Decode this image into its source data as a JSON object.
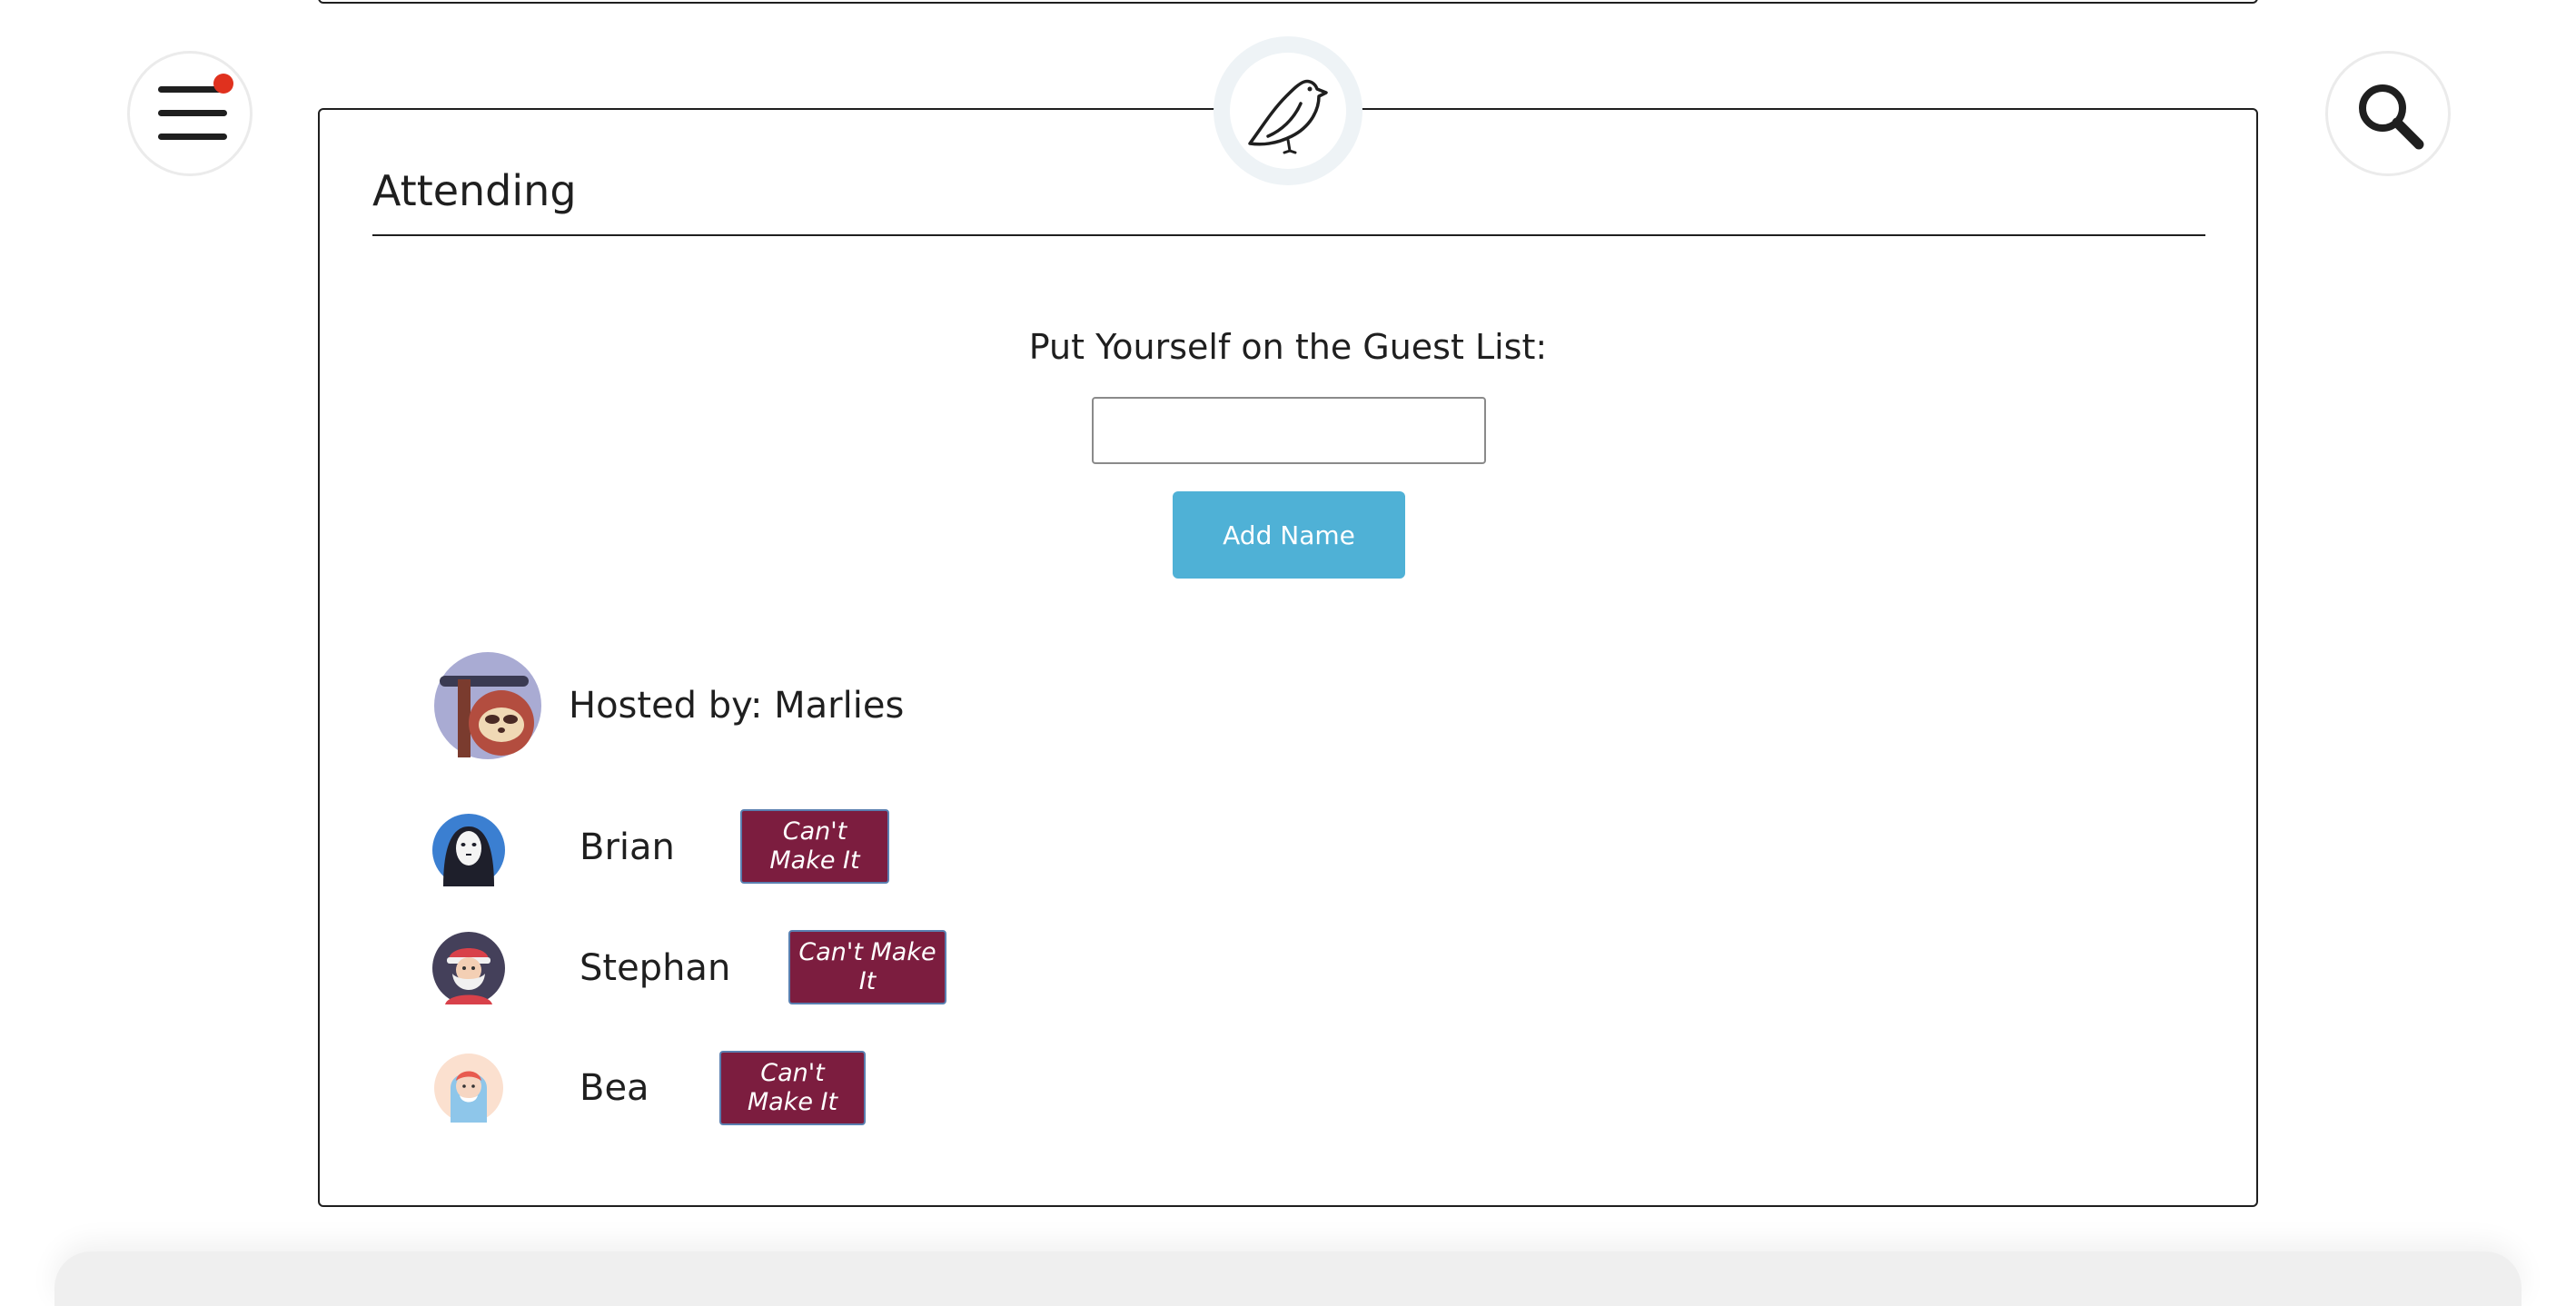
{
  "colors": {
    "accent_button": "#4fb1d6",
    "cant_button": "#7c1d3f",
    "notification_dot": "#e0311e",
    "text": "#1f1f1f"
  },
  "header": {
    "menu_icon": "hamburger-icon",
    "has_notification": true,
    "search_icon": "search-icon",
    "logo_icon": "bird-icon"
  },
  "attending": {
    "title": "Attending",
    "guest_list_label": "Put Yourself on the Guest List:",
    "name_input": {
      "value": "",
      "placeholder": ""
    },
    "add_button_label": "Add Name",
    "host": {
      "label": "Hosted by: Marlies",
      "avatar_icon": "sloth-avatar-icon"
    },
    "guests": [
      {
        "name": "Brian",
        "avatar_icon": "no-face-avatar-icon",
        "button_label": "Can't Make It"
      },
      {
        "name": "Stephan",
        "avatar_icon": "santa-avatar-icon",
        "button_label": "Can't Make It"
      },
      {
        "name": "Bea",
        "avatar_icon": "girl-avatar-icon",
        "button_label": "Can't Make It"
      }
    ]
  }
}
